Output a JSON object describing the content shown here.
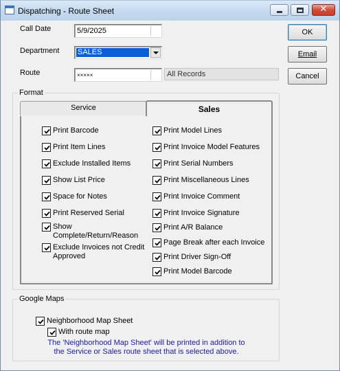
{
  "window": {
    "title": "Dispatching - Route Sheet",
    "caption_buttons": {
      "minimize": "minimize-icon",
      "maximize": "maximize-icon",
      "close": "close-icon"
    }
  },
  "fields": {
    "call_date": {
      "label": "Call Date",
      "value": "5/9/2025"
    },
    "department": {
      "label": "Department",
      "value": "SALES"
    },
    "route": {
      "label": "Route",
      "value": "×××××",
      "display": "All Records"
    }
  },
  "buttons": {
    "ok": "OK",
    "email": "Email",
    "cancel": "Cancel"
  },
  "format": {
    "caption": "Format",
    "tabs": [
      {
        "label": "Service",
        "active": false
      },
      {
        "label": "Sales",
        "active": true
      }
    ],
    "left_options": [
      {
        "label": "Print Barcode",
        "checked": true
      },
      {
        "label": "Print Item Lines",
        "checked": true
      },
      {
        "label": "Exclude Installed Items",
        "checked": true
      },
      {
        "label": "Show List Price",
        "checked": true
      },
      {
        "label": "Space for  Notes",
        "checked": true
      },
      {
        "label": "Print Reserved Serial",
        "checked": true
      },
      {
        "label": "Show Complete/Return/Reason",
        "checked": true
      },
      {
        "label": "Exclude Invoices not Credit Approved",
        "checked": true
      }
    ],
    "right_options": [
      {
        "label": "Print Model Lines",
        "checked": true
      },
      {
        "label": "Print Invoice Model Features",
        "checked": true
      },
      {
        "label": "Print Serial Numbers",
        "checked": true
      },
      {
        "label": "Print Miscellaneous Lines",
        "checked": true
      },
      {
        "label": "Print Invoice Comment",
        "checked": true
      },
      {
        "label": "Print Invoice Signature",
        "checked": true
      },
      {
        "label": "Print A/R Balance",
        "checked": true
      },
      {
        "label": "Page Break after each Invoice",
        "checked": true
      },
      {
        "label": "Print Driver Sign-Off",
        "checked": true
      },
      {
        "label": "Print Model Barcode",
        "checked": true
      }
    ]
  },
  "google_maps": {
    "caption": "Google Maps",
    "neighborhood_map": {
      "label": "Neighborhood Map Sheet",
      "checked": true
    },
    "with_route_map": {
      "label": "With route map",
      "checked": true
    },
    "note_line1": "The 'Neighborhood Map Sheet' will be printed in addition to",
    "note_line2": "the Service or Sales route sheet that is selected above."
  }
}
